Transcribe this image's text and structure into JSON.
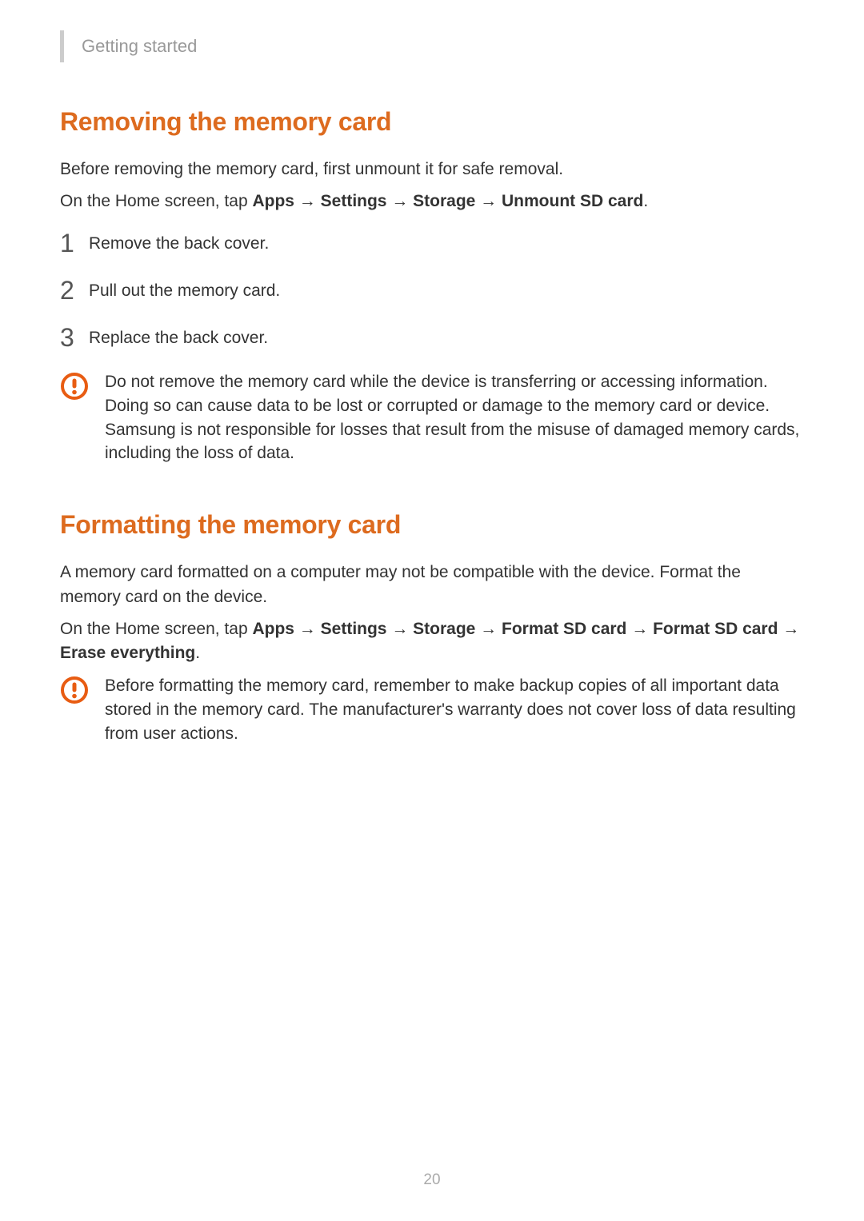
{
  "header": {
    "breadcrumb": "Getting started"
  },
  "section1": {
    "heading": "Removing the memory card",
    "intro1": "Before removing the memory card, first unmount it for safe removal.",
    "intro2_prefix": "On the Home screen, tap ",
    "path": [
      "Apps",
      "Settings",
      "Storage",
      "Unmount SD card"
    ],
    "steps": [
      "Remove the back cover.",
      "Pull out the memory card.",
      "Replace the back cover."
    ],
    "callout": "Do not remove the memory card while the device is transferring or accessing information. Doing so can cause data to be lost or corrupted or damage to the memory card or device. Samsung is not responsible for losses that result from the misuse of damaged memory cards, including the loss of data."
  },
  "section2": {
    "heading": "Formatting the memory card",
    "intro1": "A memory card formatted on a computer may not be compatible with the device. Format the memory card on the device.",
    "intro2_prefix": "On the Home screen, tap ",
    "path": [
      "Apps",
      "Settings",
      "Storage",
      "Format SD card",
      "Format SD card",
      "Erase everything"
    ],
    "callout": "Before formatting the memory card, remember to make backup copies of all important data stored in the memory card. The manufacturer's warranty does not cover loss of data resulting from user actions."
  },
  "arrow": " → ",
  "period": ".",
  "page_number": "20"
}
